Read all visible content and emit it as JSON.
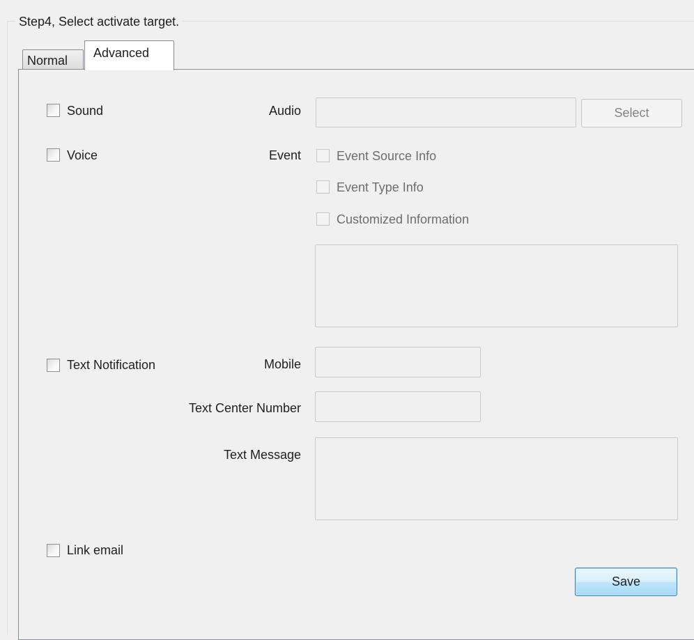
{
  "group": {
    "title": "Step4, Select activate target."
  },
  "tabs": [
    {
      "label": "Normal",
      "active": false
    },
    {
      "label": "Advanced",
      "active": true
    }
  ],
  "sound": {
    "label": "Sound",
    "checked": false,
    "audio_label": "Audio",
    "audio_value": "",
    "select_button": "Select"
  },
  "voice": {
    "label": "Voice",
    "checked": false,
    "event_label": "Event",
    "options": [
      {
        "label": "Event Source Info",
        "checked": false
      },
      {
        "label": "Event Type Info",
        "checked": false
      },
      {
        "label": "Customized Information",
        "checked": false
      }
    ],
    "custom_text": ""
  },
  "text_notification": {
    "label": "Text Notification",
    "checked": false,
    "mobile_label": "Mobile",
    "mobile_value": "",
    "center_label": "Text Center Number",
    "center_value": "",
    "message_label": "Text Message",
    "message_value": ""
  },
  "link_email": {
    "label": "Link email",
    "checked": false
  },
  "save_button": "Save"
}
